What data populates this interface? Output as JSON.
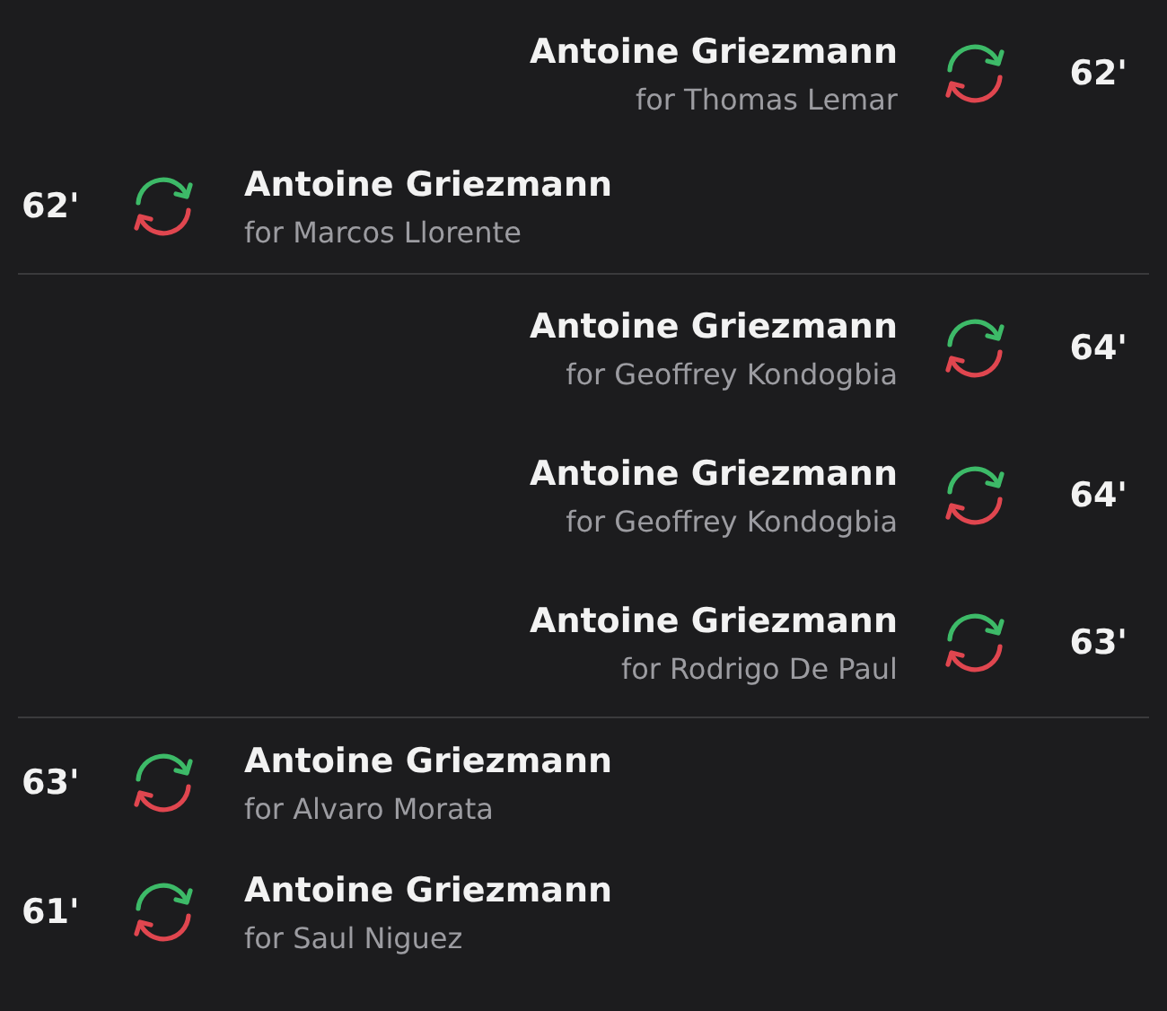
{
  "groups": [
    {
      "events": [
        {
          "kind": "right",
          "player": "Antoine Griezmann",
          "replaced": "for Thomas Lemar",
          "minute": "62'"
        },
        {
          "kind": "left",
          "player": "Antoine Griezmann",
          "replaced": "for Marcos Llorente",
          "minute": "62'"
        }
      ]
    },
    {
      "events": [
        {
          "kind": "right",
          "player": "Antoine Griezmann",
          "replaced": "for Geoffrey Kondogbia",
          "minute": "64'"
        },
        {
          "kind": "right",
          "player": "Antoine Griezmann",
          "replaced": "for Geoffrey Kondogbia",
          "minute": "64'"
        },
        {
          "kind": "right",
          "player": "Antoine Griezmann",
          "replaced": "for Rodrigo De Paul",
          "minute": "63'"
        }
      ]
    },
    {
      "events": [
        {
          "kind": "left",
          "player": "Antoine Griezmann",
          "replaced": "for Alvaro Morata",
          "minute": "63'"
        },
        {
          "kind": "left",
          "player": "Antoine Griezmann",
          "replaced": "for Saul Niguez",
          "minute": "61'"
        }
      ]
    }
  ]
}
